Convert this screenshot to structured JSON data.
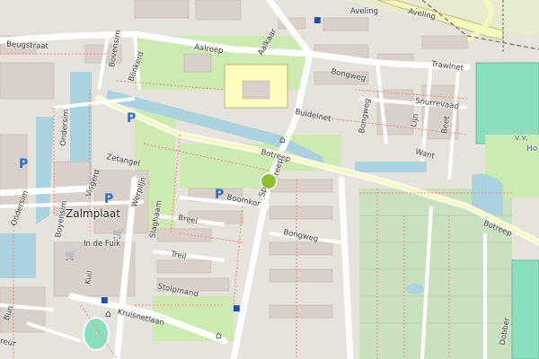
{
  "map": {
    "streets": {
      "aveling": "Aveling",
      "aveling_east": "Aveling",
      "beugstraat": "Beugstraat",
      "aalreep": "Aalreep",
      "aalkaar": "Aalkaar",
      "bongweg": "Bongweg",
      "bongweg_vertical": "Bongweg",
      "bongweg_south": "Bongweg",
      "trawlnet": "Trawlnet",
      "snurrevaad": "Snurrevaad",
      "buidelnet": "Buidelnet",
      "lijn": "Lijn",
      "beet": "Beet",
      "want": "Want",
      "botreep": "Botreep",
      "botreep_east": "Botreep",
      "bovensim": "Bovensim",
      "blinkerd": "Blinkerd",
      "ondersim_north": "Ondersim",
      "ondersim_south": "Ondersim",
      "zetangel": "Zetangel",
      "visgerd": "Visgerd",
      "werpiljn": "Werpiljn",
      "boyensim": "Boyensim",
      "slaghaam": "Slaghaam",
      "boomkor": "Boomkor",
      "breel": "Breel",
      "treil": "Treil",
      "stolpmand": "Stolpmand",
      "in_de_fuik": "In de Fuik",
      "kuil": "Kuil",
      "kruisnetlaan": "Kruisnetlaan",
      "spanreep": "Sp",
      "spanreep_2": "reep",
      "bun": "Bun",
      "dobber": "Dobber",
      "reur": "reur"
    },
    "places": {
      "zalmplaat": "Zalmplaat",
      "vv_label": "v.v.",
      "ho_label": "Ho"
    },
    "parking_symbol": "P",
    "colors": {
      "residential": "#e6e2dc",
      "building": "#d9d0c9",
      "park": "#cdebb0",
      "water": "#aad3df",
      "pitch": "#88e0be",
      "school": "#fffcc0",
      "road_major": "#f7fabf",
      "road_minor": "#ffffff",
      "footpath": "#fa8072",
      "allotment": "#c9e1bf",
      "marker": "#8fbf2f"
    },
    "icons": {
      "tram_stop": "tram-stop-icon",
      "shop": "shopping-cart-icon",
      "shelter": "shelter-icon",
      "current_location": "location-marker-icon"
    }
  }
}
